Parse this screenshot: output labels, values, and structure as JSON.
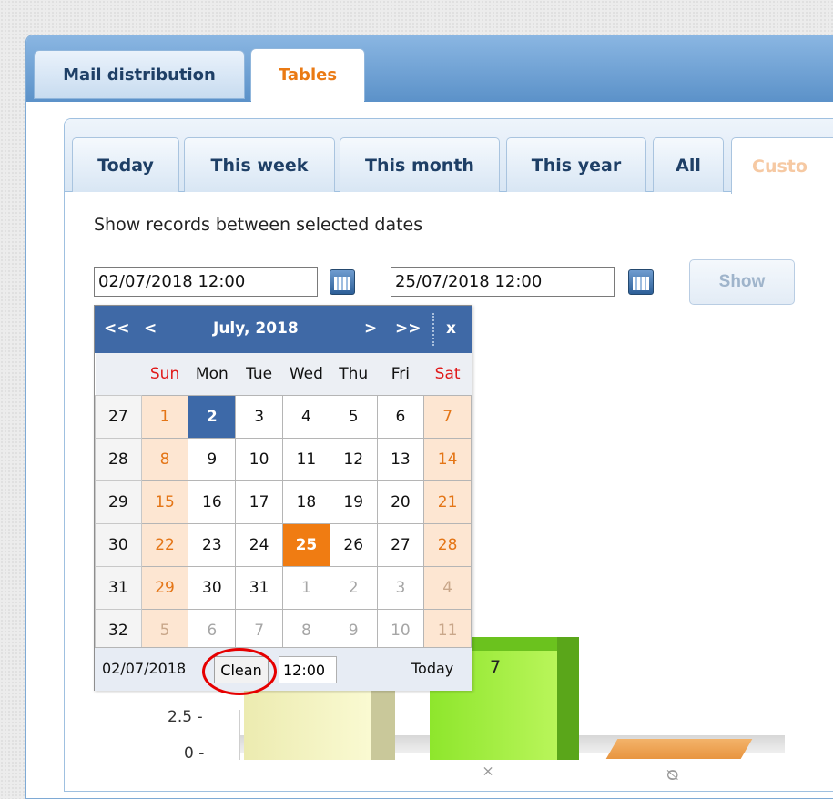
{
  "outer_tabs": [
    {
      "label": "Mail distribution",
      "active": false
    },
    {
      "label": "Tables",
      "active": true
    }
  ],
  "period_tabs": [
    {
      "label": "Today",
      "active": false
    },
    {
      "label": "This week",
      "active": false
    },
    {
      "label": "This month",
      "active": false
    },
    {
      "label": "This year",
      "active": false
    },
    {
      "label": "All",
      "active": false
    },
    {
      "label": "Custo",
      "active": true
    }
  ],
  "caption": "Show records between selected dates",
  "date_from": "02/07/2018 12:00",
  "date_to": "25/07/2018 12:00",
  "show_button": "Show",
  "calendar": {
    "nav": {
      "prev_year": "<<",
      "prev_month": "<",
      "title": "July, 2018",
      "next_month": ">",
      "next_year": ">>",
      "close": "x"
    },
    "weekdays": [
      "Sun",
      "Mon",
      "Tue",
      "Wed",
      "Thu",
      "Fri",
      "Sat"
    ],
    "weeks": [
      {
        "num": "27",
        "days": [
          "1",
          "2",
          "3",
          "4",
          "5",
          "6",
          "7"
        ]
      },
      {
        "num": "28",
        "days": [
          "8",
          "9",
          "10",
          "11",
          "12",
          "13",
          "14"
        ]
      },
      {
        "num": "29",
        "days": [
          "15",
          "16",
          "17",
          "18",
          "19",
          "20",
          "21"
        ]
      },
      {
        "num": "30",
        "days": [
          "22",
          "23",
          "24",
          "25",
          "26",
          "27",
          "28"
        ]
      },
      {
        "num": "31",
        "days": [
          "29",
          "30",
          "31",
          "1",
          "2",
          "3",
          "4"
        ]
      },
      {
        "num": "32",
        "days": [
          "5",
          "6",
          "7",
          "8",
          "9",
          "10",
          "11"
        ]
      }
    ],
    "selected_day": "2",
    "highlighted_day": "25",
    "footer": {
      "date": "02/07/2018",
      "clean": "Clean",
      "time": "12:00",
      "today": "Today"
    }
  },
  "chart": {
    "ticks": [
      "2.5 -",
      "0 -"
    ],
    "value_label": "7",
    "x_fragments": [
      "×",
      "Ø"
    ]
  },
  "colors": {
    "accent": "#ea7a14",
    "nav_blue": "#3f69a6",
    "highlight_ring": "#e60000"
  }
}
